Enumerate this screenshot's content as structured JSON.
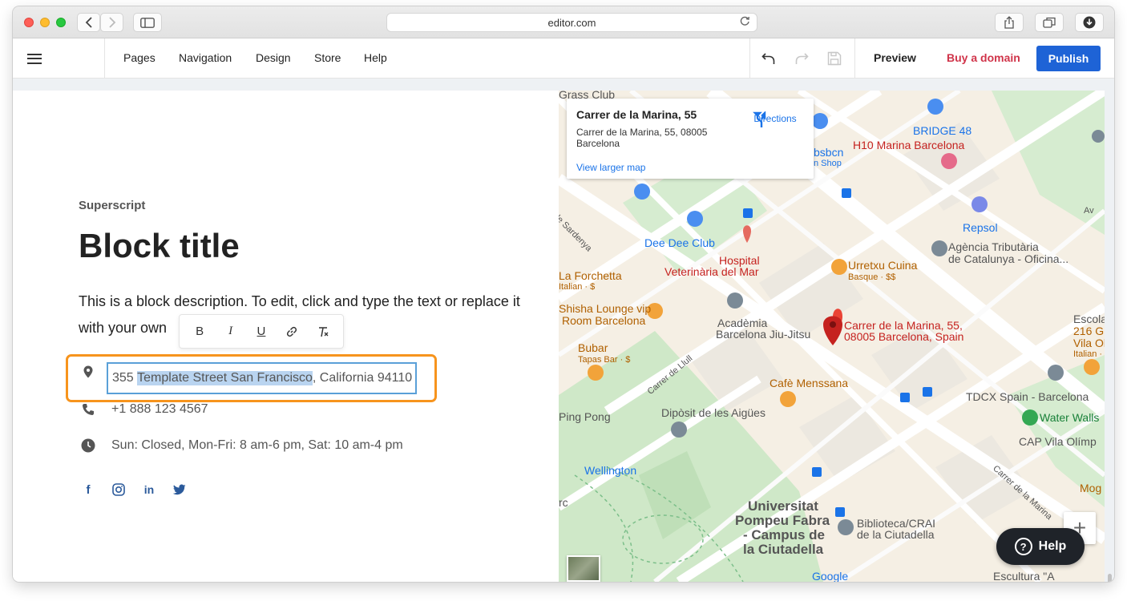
{
  "browser": {
    "url": "editor.com"
  },
  "toolbar": {
    "nav": [
      "Pages",
      "Navigation",
      "Design",
      "Store",
      "Help"
    ],
    "preview": "Preview",
    "buy_domain": "Buy a domain",
    "publish": "Publish",
    "accent": "#1e63d6",
    "buy_color": "#d0344a"
  },
  "block": {
    "superscript": "Superscript",
    "title": "Block title",
    "description": "This is a block description. To edit, click and type the text or replace it with your own",
    "address_prefix": "355 ",
    "address_selected": "Template Street San Francisco",
    "address_suffix": ", California 94110",
    "phone": "+1 888 123 4567",
    "hours": "Sun: Closed, Mon-Fri: 8 am-6 pm, Sat: 10 am-4 pm",
    "social": [
      "facebook-icon",
      "instagram-icon",
      "linkedin-icon",
      "twitter-icon"
    ],
    "highlight_color": "#f7941d"
  },
  "format_bar": {
    "bold": "B",
    "italic": "I",
    "underline": "U"
  },
  "map": {
    "card": {
      "title": "Carrer de la Marina, 55",
      "address": "Carrer de la Marina, 55, 08005 Barcelona",
      "larger_map": "View larger map",
      "directions": "Directions"
    },
    "labels": {
      "grass_club": "Grass Club",
      "bridge": "BRIDGE 48",
      "h10": "H10 Marina Barcelona",
      "bsbcn": "bsbcn",
      "shop": "n Shop",
      "sardenya": "de Sardenya",
      "dee_dee": "Dee Dee Club",
      "hospital_1": "Hospital",
      "hospital_2": "Veterinària del Mar",
      "repsol": "Repsol",
      "agencia_1": "Agència Tributària",
      "agencia_2": "de Catalunya - Oficina...",
      "av": "Av",
      "forchetta": "La Forchetta",
      "forchetta_sub": "Italian · $",
      "urretxu": "Urretxu Cuina",
      "urretxu_sub": "Basque · $$",
      "shisha_1": "Shisha Lounge vip",
      "shisha_2": "Room Barcelona",
      "academia_1": "Acadèmia",
      "academia_2": "Barcelona Jiu-Jitsu",
      "pin_1": "Carrer de la Marina, 55,",
      "pin_2": "08005 Barcelona, Spain",
      "escola": "Escola",
      "l216": "216 G",
      "vila": "Vila Ol",
      "italian": "Italian ·",
      "bubar": "Bubar",
      "bubar_sub": "Tapas Bar · $",
      "llull": "Carrer de Llull",
      "cafe": "Cafè Menssana",
      "tdcx": "TDCX Spain - Barcelona",
      "water": "Water Walls",
      "ping": "Ping Pong",
      "diposit": "Dipòsit de les Aigües",
      "cap": "CAP Vila Olímp",
      "wellington": "Wellington",
      "marina": "Carrer de la Marina",
      "mog": "Mog",
      "rc": "rc",
      "upf_1": "Universitat",
      "upf_2": "Pompeu Fabra",
      "upf_3": "- Campus de",
      "upf_4": "la Ciutadella",
      "biblio_1": "Biblioteca/CRAI",
      "biblio_2": "de la Ciutadella",
      "google": "Google",
      "escultura": "Escultura \"A"
    },
    "zoom_in": "+"
  },
  "help": {
    "label": "Help"
  }
}
